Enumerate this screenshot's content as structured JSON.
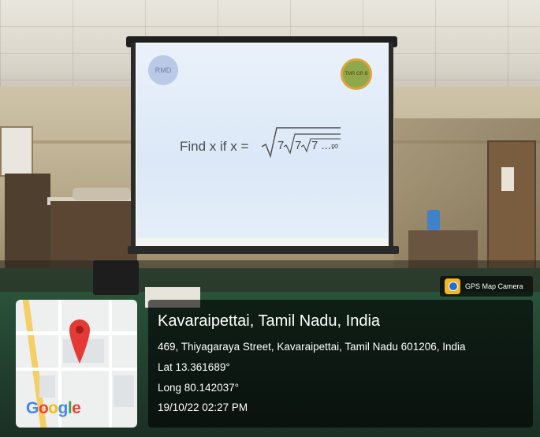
{
  "photo": {
    "slide": {
      "logo_left": "RMD",
      "logo_right": "TMR GR B",
      "text": "Find x if x = ",
      "math": "√(7√(7√(7 .... ∞)))"
    }
  },
  "badge": {
    "label": "GPS Map Camera",
    "icon": "camera-icon"
  },
  "map": {
    "brand": "Google",
    "pin_color": "#e53935"
  },
  "location": {
    "title": "Kavaraipettai, Tamil Nadu, India",
    "address": "469, Thiyagaraya Street, Kavaraipettai, Tamil Nadu 601206, India",
    "lat": "Lat 13.361689°",
    "long": "Long 80.142037°",
    "datetime": "19/10/22 02:27 PM"
  }
}
